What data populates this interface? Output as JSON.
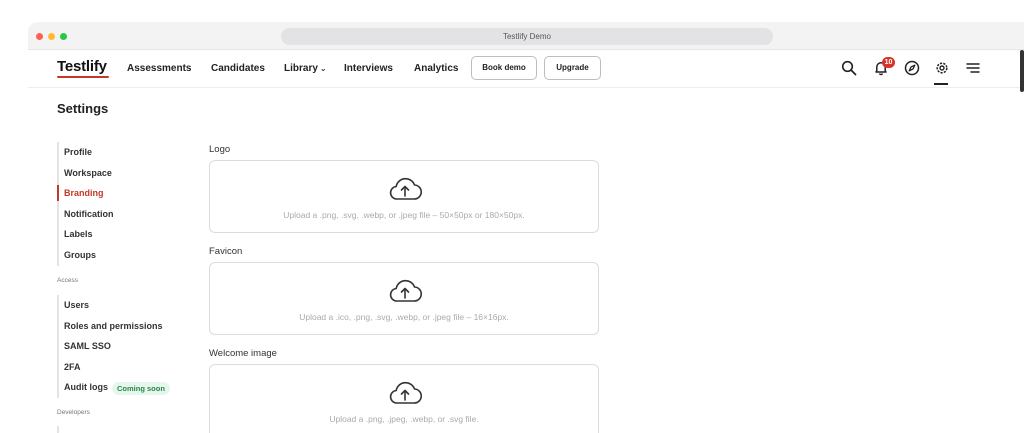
{
  "browser": {
    "tab_title": "Testlify Demo"
  },
  "header": {
    "logo": "Testlify",
    "nav": [
      {
        "label": "Assessments"
      },
      {
        "label": "Candidates"
      },
      {
        "label": "Library"
      },
      {
        "label": "Interviews"
      },
      {
        "label": "Analytics"
      }
    ],
    "book_demo": "Book demo",
    "upgrade": "Upgrade",
    "notification_count": "10",
    "icons": [
      "search-icon",
      "bell-icon",
      "compass-icon",
      "gear-icon",
      "menu-icon"
    ]
  },
  "page": {
    "title": "Settings"
  },
  "sidebar": {
    "general": [
      {
        "label": "Profile"
      },
      {
        "label": "Workspace"
      },
      {
        "label": "Branding"
      },
      {
        "label": "Notification"
      },
      {
        "label": "Labels"
      },
      {
        "label": "Groups"
      }
    ],
    "access_title": "Access",
    "access": [
      {
        "label": "Users"
      },
      {
        "label": "Roles and permissions"
      },
      {
        "label": "SAML SSO"
      },
      {
        "label": "2FA"
      },
      {
        "label": "Audit logs",
        "badge": "Coming soon"
      }
    ],
    "developers_title": "Developers"
  },
  "branding": {
    "fields": [
      {
        "label": "Logo",
        "hint": "Upload a .png, .svg, .webp, or .jpeg file – 50×50px or 180×50px."
      },
      {
        "label": "Favicon",
        "hint": "Upload a .ico, .png, .svg, .webp, or .jpeg file – 16×16px."
      },
      {
        "label": "Welcome image",
        "hint": "Upload a .png, .jpeg, .webp, or .svg file."
      }
    ]
  },
  "colors": {
    "accent": "#c0392b",
    "badge": "#d9342b",
    "coming_soon_bg": "#e6f6ec",
    "coming_soon_text": "#27864a"
  }
}
